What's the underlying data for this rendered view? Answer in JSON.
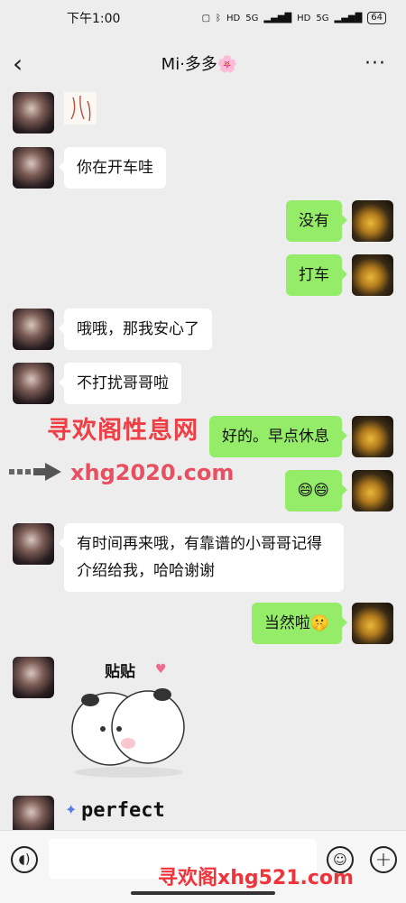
{
  "status": {
    "time": "下午1:00",
    "network_1": "5G",
    "network_2": "5G",
    "hd": "HD",
    "battery": "64"
  },
  "header": {
    "title": "Mi·多多🌸",
    "more": "···"
  },
  "messages": [
    {
      "side": "left",
      "text": "你在开车哇"
    },
    {
      "side": "right",
      "text": "没有"
    },
    {
      "side": "right",
      "text": "打车"
    },
    {
      "side": "left",
      "text": "哦哦，那我安心了"
    },
    {
      "side": "left",
      "text": "不打扰哥哥啦"
    },
    {
      "side": "right",
      "text": "好的。早点休息"
    },
    {
      "side": "right",
      "text": "😄😄"
    },
    {
      "side": "left",
      "text": "有时间再来哦，有靠谱的小哥哥记得介绍给我，哈哈谢谢"
    },
    {
      "side": "right",
      "text": "当然啦🤫"
    }
  ],
  "stickers": {
    "hug_label": "贴贴",
    "perfect_label": "perfect"
  },
  "watermarks": {
    "line1": "寻欢阁性息网",
    "line2": "xhg2020.com",
    "line3": "寻欢阁xhg521.com"
  },
  "input": {
    "placeholder": ""
  },
  "colors": {
    "bubble_self": "#95ec69",
    "bubble_other": "#ffffff",
    "background": "#ededed"
  }
}
